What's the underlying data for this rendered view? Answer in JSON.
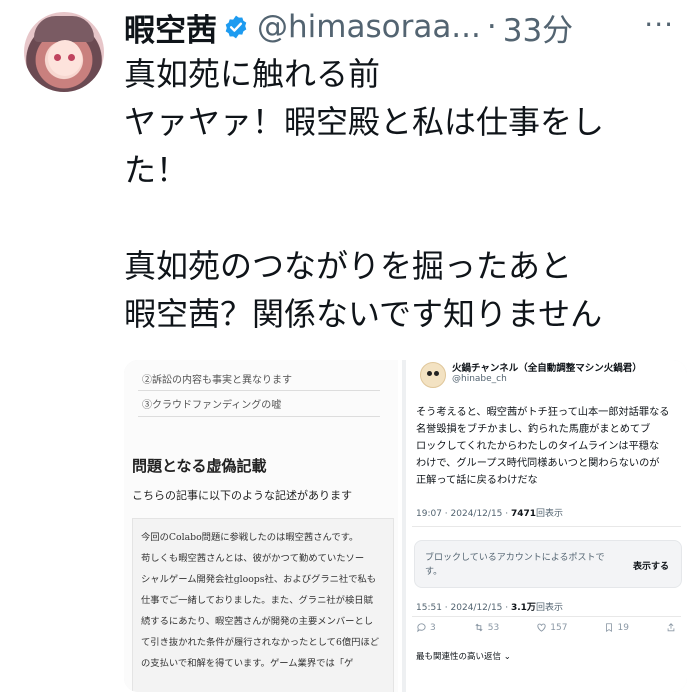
{
  "post": {
    "author_name": "暇空茜",
    "handle": "@himasoraa...",
    "separator": "·",
    "time": "33分",
    "more_label": "···",
    "verified_icon": "verified-badge-icon",
    "lines": [
      "真如苑に触れる前",
      "ヤァヤァ！暇空殿と私は仕事をし",
      "た！",
      "",
      "真如苑のつながりを掘ったあと",
      "暇空茜？関係ないです知りません"
    ]
  },
  "left_image": {
    "items": [
      "②訴訟の内容も事実と異なります",
      "③クラウドファンディングの嘘"
    ],
    "heading": "問題となる虚偽記載",
    "subheading": "こちらの記事に以下のような記述があります",
    "quote_lines": [
      "今回のColabo問題に参戦したのは暇空茜さんです。",
      "苟しくも暇空茜さんとは、彼がかつて勤めていたソー",
      "シャルゲーム開発会社gloops社、およびグラニ社で私も",
      "仕事でご一緒しておりました。また、グラニ社が検日賦",
      "続するにあたり、暇空茜さんが開発の主要メンバーとし",
      "て引き抜かれた条件が履行されなかったとして6億円ほど",
      "の支払いで和解を得ています。ゲーム業界では「ゲ"
    ]
  },
  "right_image": {
    "name": "火鍋チャンネル（全自動調整マシン火鍋君）",
    "handle": "@hinabe_ch",
    "body_lines": [
      "そう考えると、暇空茜がトチ狂って山本一郎対話罪なる",
      "名誉毀損をブチかまし、釣られた馬鹿がまとめてブ",
      "ロックしてくれたからわたしのタイムラインは平穏な",
      "わけで、グループス時代同様あいつと関わらないのが",
      "正解って話に戻るわけだな"
    ],
    "meta1": "19:07 · 2024/12/15 · ",
    "views1": "7471",
    "views1_suffix": "回表示",
    "blocked_line1": "ブロックしているアカウントによるポストで",
    "blocked_line2": "す。",
    "show_label": "表示する",
    "meta2": "15:51 · 2024/12/15 · ",
    "views2": "3.1万",
    "views2_suffix": "回表示",
    "replies": "3",
    "retweets": "53",
    "likes": "157",
    "bookmarks": "19",
    "sort_label": "最も関連性の高い返信 ⌄"
  }
}
